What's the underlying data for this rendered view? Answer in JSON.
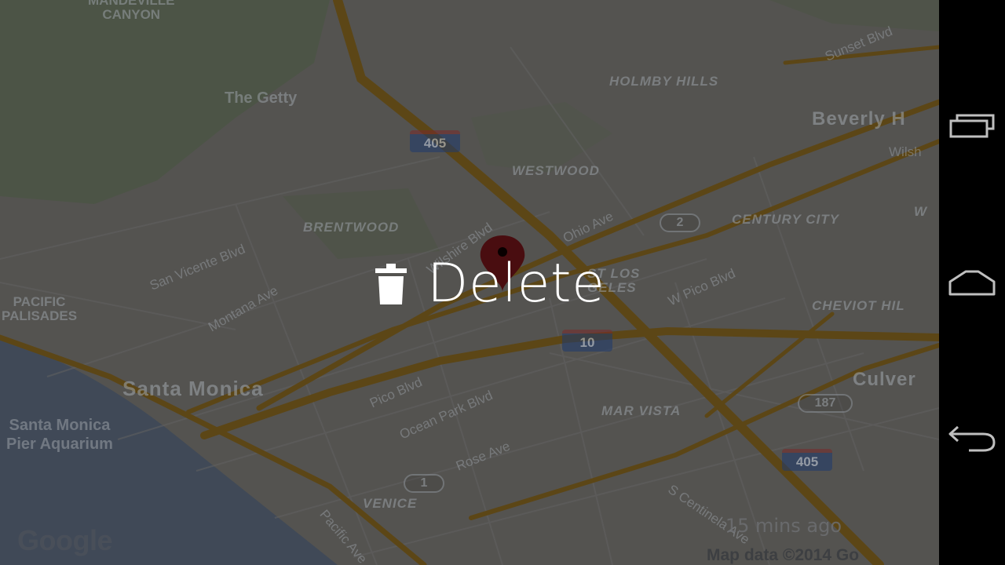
{
  "map": {
    "labels": {
      "mandeville_canyon": "MANDEVILLE\nCANYON",
      "holmby_hills": "HOLMBY HILLS",
      "the_getty": "The Getty",
      "beverly_hills": "Beverly H",
      "westwood": "WESTWOOD",
      "sunset_blvd": "Sunset Blvd",
      "wilshire_east": "Wilsh",
      "brentwood": "BRENTWOOD",
      "san_vicente": "San Vicente Blvd",
      "wilshire_blvd": "Wilshire Blvd",
      "ohio_ave": "Ohio Ave",
      "century_city": "CENTURY CITY",
      "w_label": "W",
      "pacific_palisades": "PACIFIC\nPALISADES",
      "montana_ave": "Montana Ave",
      "west_los_angeles": "ST LOS\nGELES",
      "w_pico_blvd": "W Pico Blvd",
      "cheviot_hills": "CHEVIOT HIL",
      "santa_monica": "Santa Monica",
      "pico_blvd": "Pico Blvd",
      "ocean_park": "Ocean Park Blvd",
      "mar_vista": "MAR VISTA",
      "culver": "Culver",
      "pier_aquarium": "Santa Monica\nPier Aquarium",
      "rose_ave": "Rose Ave",
      "venice": "VENICE",
      "pacific_ave": "Pacific Ave",
      "s_centinela": "S Centinela Ave"
    },
    "shields": {
      "i405_north": "405",
      "i10": "10",
      "i405_south": "405",
      "r2": "2",
      "r187": "187",
      "r1": "1"
    },
    "google_logo": "Google",
    "copyright": "Map data ©2014 Go",
    "pin_color": "#9b1c22"
  },
  "card": {
    "action_label": "Delete",
    "action_icon": "trash-icon",
    "timestamp": "15 mins ago"
  },
  "navbar": {
    "recents_icon": "recent-apps-icon",
    "home_icon": "home-icon",
    "back_icon": "back-icon"
  },
  "colors": {
    "map_land": "#dcd9d2",
    "map_water": "#a9c1e4",
    "map_park": "#c6dcb4",
    "highway": "#f2b83a",
    "navbar": "#000000",
    "action_text": "#ffffff"
  }
}
